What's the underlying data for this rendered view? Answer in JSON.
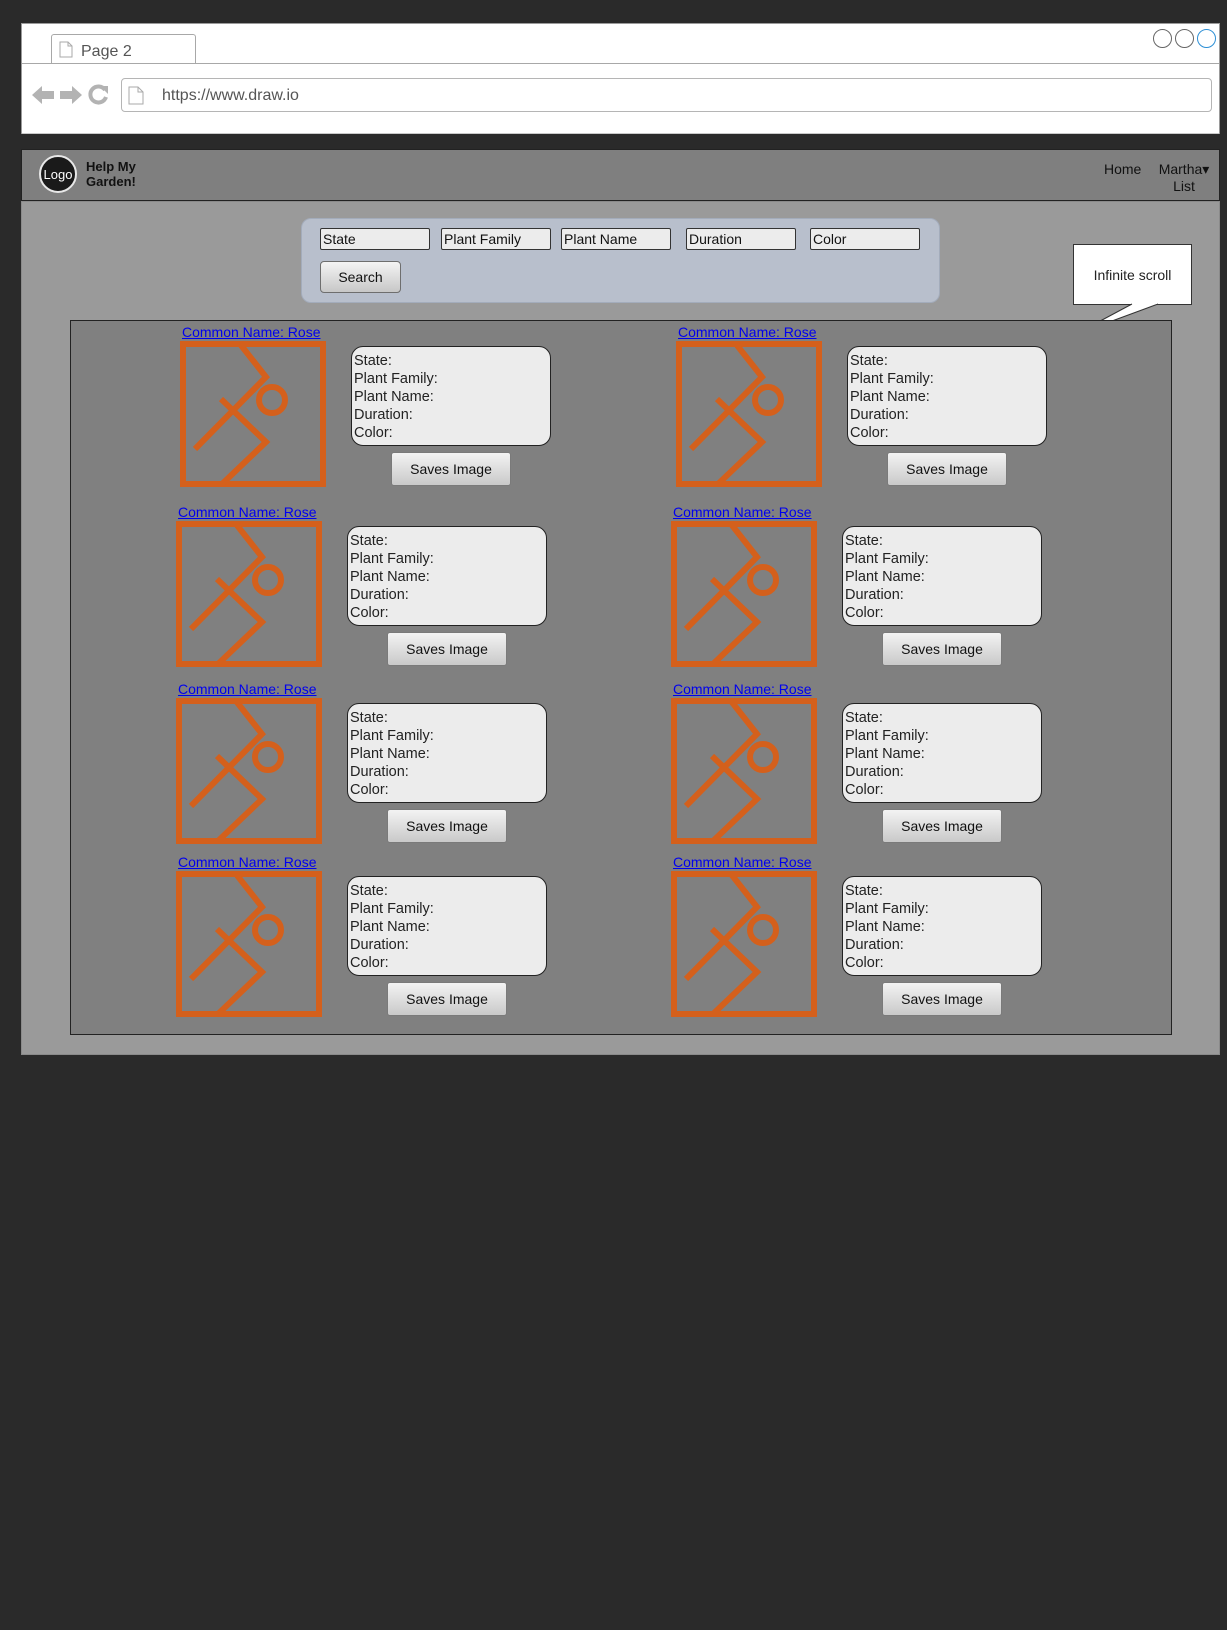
{
  "browser": {
    "tab_label": "Page 2",
    "url": "https://www.draw.io"
  },
  "header": {
    "logo_text": "Logo",
    "brand_line1": "Help My",
    "brand_line2": "Garden!",
    "nav_home": "Home",
    "nav_user": "Martha▾",
    "nav_list": "List"
  },
  "search": {
    "fields": [
      "State",
      "Plant Family",
      "Plant Name",
      "Duration",
      "Color"
    ],
    "button_label": "Search"
  },
  "annotation": {
    "callout_text": "Infinite scroll"
  },
  "results": {
    "accent_color": "#d4601c",
    "cards": [
      {
        "title": "Common Name: Rose",
        "state": "State:",
        "family": "Plant Family:",
        "name": "Plant Name:",
        "duration": "Duration:",
        "color": "Color:",
        "button": "Saves Image"
      },
      {
        "title": "Common Name: Rose",
        "state": "State:",
        "family": "Plant Family:",
        "name": "Plant Name:",
        "duration": "Duration:",
        "color": "Color:",
        "button": "Saves Image"
      },
      {
        "title": "Common Name: Rose",
        "state": "State:",
        "family": "Plant Family:",
        "name": "Plant Name:",
        "duration": "Duration:",
        "color": "Color:",
        "button": "Saves Image"
      },
      {
        "title": "Common Name: Rose",
        "state": "State:",
        "family": "Plant Family:",
        "name": "Plant Name:",
        "duration": "Duration:",
        "color": "Color:",
        "button": "Saves Image"
      },
      {
        "title": "Common Name: Rose",
        "state": "State:",
        "family": "Plant Family:",
        "name": "Plant Name:",
        "duration": "Duration:",
        "color": "Color:",
        "button": "Saves Image"
      },
      {
        "title": "Common Name: Rose",
        "state": "State:",
        "family": "Plant Family:",
        "name": "Plant Name:",
        "duration": "Duration:",
        "color": "Color:",
        "button": "Saves Image"
      },
      {
        "title": "Common Name: Rose",
        "state": "State:",
        "family": "Plant Family:",
        "name": "Plant Name:",
        "duration": "Duration:",
        "color": "Color:",
        "button": "Saves Image"
      },
      {
        "title": "Common Name: Rose",
        "state": "State:",
        "family": "Plant Family:",
        "name": "Plant Name:",
        "duration": "Duration:",
        "color": "Color:",
        "button": "Saves Image"
      }
    ]
  }
}
